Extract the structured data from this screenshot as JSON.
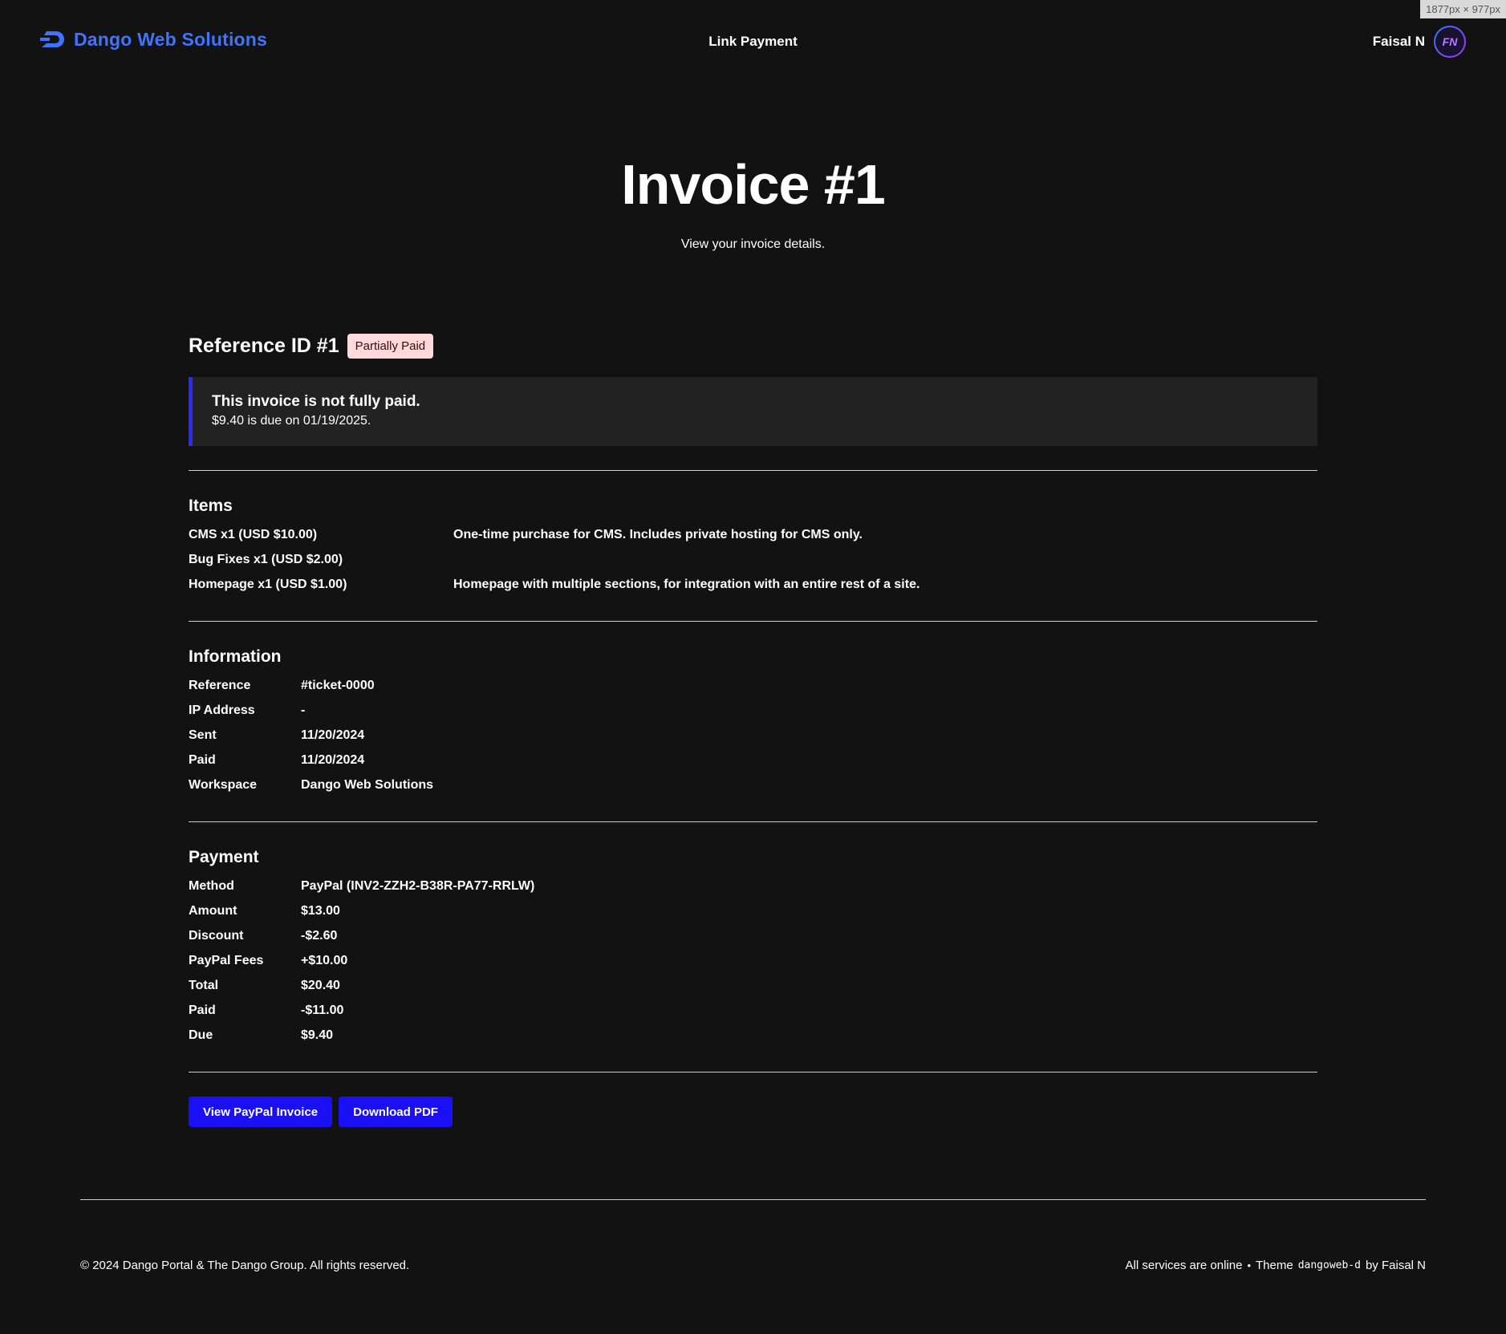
{
  "header": {
    "brand": "Dango Web Solutions",
    "nav_link": "Link Payment",
    "user_name": "Faisal N",
    "avatar_initials": "FN",
    "size_tag": "1877px × 977px"
  },
  "hero": {
    "title": "Invoice #1",
    "subtitle": "View your invoice details."
  },
  "reference": {
    "title": "Reference ID #1",
    "status": "Partially Paid"
  },
  "alert": {
    "title": "This invoice is not fully paid.",
    "text": "$9.40 is due on 01/19/2025."
  },
  "items": {
    "title": "Items",
    "rows": [
      {
        "name": "CMS x1 (USD $10.00)",
        "desc": "One-time purchase for CMS. Includes private hosting for CMS only."
      },
      {
        "name": "Bug Fixes x1 (USD $2.00)",
        "desc": ""
      },
      {
        "name": "Homepage x1 (USD $1.00)",
        "desc": "Homepage with multiple sections, for integration with an entire rest of a site."
      }
    ]
  },
  "information": {
    "title": "Information",
    "rows": [
      {
        "label": "Reference",
        "value": "#ticket-0000"
      },
      {
        "label": "IP Address",
        "value": "-"
      },
      {
        "label": "Sent",
        "value": "11/20/2024"
      },
      {
        "label": "Paid",
        "value": "11/20/2024"
      },
      {
        "label": "Workspace",
        "value": "Dango Web Solutions"
      }
    ]
  },
  "payment": {
    "title": "Payment",
    "rows": [
      {
        "label": "Method",
        "value": "PayPal (INV2-ZZH2-B38R-PA77-RRLW)"
      },
      {
        "label": "Amount",
        "value": "$13.00"
      },
      {
        "label": "Discount",
        "value": "-$2.60"
      },
      {
        "label": "PayPal Fees",
        "value": "+$10.00"
      },
      {
        "label": "Total",
        "value": "$20.40"
      },
      {
        "label": "Paid",
        "value": "-$11.00"
      },
      {
        "label": "Due",
        "value": "$9.40"
      }
    ]
  },
  "buttons": {
    "view_paypal": "View PayPal Invoice",
    "download_pdf": "Download PDF"
  },
  "footer": {
    "copyright": "© 2024 Dango Portal & The Dango Group. All rights reserved.",
    "status": "All services are online",
    "separator": "•",
    "theme_prefix": "Theme",
    "theme_name": "dangoweb-d",
    "theme_suffix": "by Faisal N"
  },
  "colors": {
    "background": "#121212",
    "accent": "#1a10f5",
    "brand": "#3f74ff",
    "badge_bg": "#ffd9dc"
  }
}
